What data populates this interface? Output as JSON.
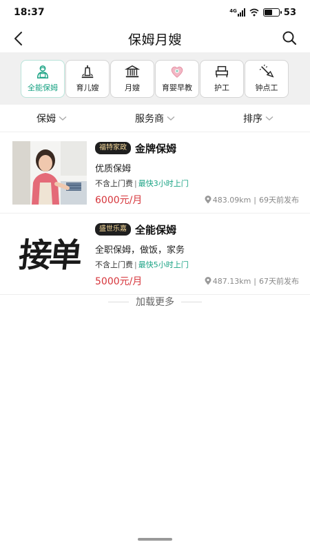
{
  "status_bar": {
    "time": "18:37",
    "network": "4G",
    "battery": "53",
    "battery_level": 0.53,
    "icons": [
      "signal-icon",
      "wifi-icon",
      "battery-icon"
    ]
  },
  "nav": {
    "title": "保姆月嫂",
    "back_icon": "chevron-left-icon",
    "search_icon": "search-icon"
  },
  "categories": [
    {
      "label": "全能保姆",
      "icon": "nanny-icon",
      "active": true
    },
    {
      "label": "育儿嫂",
      "icon": "baby-bottle-icon",
      "active": false
    },
    {
      "label": "月嫂",
      "icon": "building-icon",
      "active": false
    },
    {
      "label": "育婴早教",
      "icon": "heart-baby-icon",
      "active": false
    },
    {
      "label": "护工",
      "icon": "bed-icon",
      "active": false
    },
    {
      "label": "钟点工",
      "icon": "cleaning-icon",
      "active": false
    }
  ],
  "colors": {
    "accent": "#1aa384",
    "price": "#d6343a",
    "badge_bg": "#1f1f1f",
    "badge_text": "#f5d89a"
  },
  "filters": [
    {
      "label": "保姆"
    },
    {
      "label": "服务商"
    },
    {
      "label": "排序"
    }
  ],
  "listings": [
    {
      "company": "福特家政",
      "title": "金牌保姆",
      "description": "优质保姆",
      "fee_note": "不含上门费",
      "separator": "|",
      "fast_note": "最快3小时上门",
      "price": "6000元/月",
      "distance": "483.09km",
      "posted": "69天前发布",
      "meta_sep": "|",
      "image": "woman-in-kitchen-photo"
    },
    {
      "company": "盛世乐嘉",
      "title": "全能保姆",
      "description": "全职保姆，做饭，家务",
      "fee_note": "不含上门费",
      "separator": "|",
      "fast_note": "最快5小时上门",
      "price": "5000元/月",
      "distance": "487.13km",
      "posted": "67天前发布",
      "meta_sep": "|",
      "image": "calligraphy-image",
      "image_text": "接单"
    }
  ],
  "load_more": "加载更多"
}
